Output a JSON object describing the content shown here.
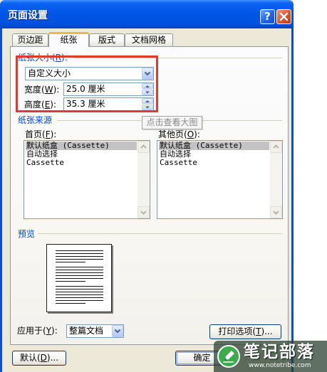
{
  "window": {
    "title": "页面设置",
    "help_label": "?"
  },
  "active_tab": 1,
  "tabs": [
    {
      "label": "页边距"
    },
    {
      "label": "纸张"
    },
    {
      "label": "版式"
    },
    {
      "label": "文档网格"
    }
  ],
  "paper_size": {
    "heading": "纸张大小(R):",
    "selected": "自定义大小",
    "width_label": "宽度(W):",
    "width_value": "25.0 厘米",
    "height_label": "高度(E):",
    "height_value": "35.3 厘米"
  },
  "tooltip": "点击查看大图",
  "paper_source": {
    "heading": "纸张来源",
    "first_page": {
      "label": "首页(F):",
      "items": [
        "默认纸盒 (Cassette)",
        "自动选择",
        "Cassette"
      ],
      "selected_index": 0
    },
    "other_pages": {
      "label": "其他页(O):",
      "items": [
        "默认纸盒 (Cassette)",
        "自动选择",
        "Cassette"
      ],
      "selected_index": 0
    }
  },
  "preview": {
    "heading": "预览"
  },
  "apply_to": {
    "label": "应用于(Y):",
    "selected": "整篇文档"
  },
  "print_options_button": "打印选项(T)...",
  "footer": {
    "default_button": "默认(D)...",
    "ok_button": "确定"
  },
  "watermark": {
    "name": "笔记部落",
    "url": "www.notetribe.com"
  },
  "icons": {
    "help": "help-icon",
    "close": "close-icon",
    "dropdown": "chevron-down-icon",
    "spin_up": "spin-up-icon",
    "spin_down": "spin-down-icon",
    "scroll_up": "scroll-up-icon",
    "scroll_down": "scroll-down-icon",
    "watermark_logo": "pen-logo-icon"
  },
  "colors": {
    "title_bar": "#0055E5",
    "dialog_bg": "#ECE9D8",
    "section_heading": "#0046D5",
    "annotation_box": "#DD3B2E",
    "list_selection": "#C3C3C3",
    "watermark_logo": "#3DAA4E"
  }
}
